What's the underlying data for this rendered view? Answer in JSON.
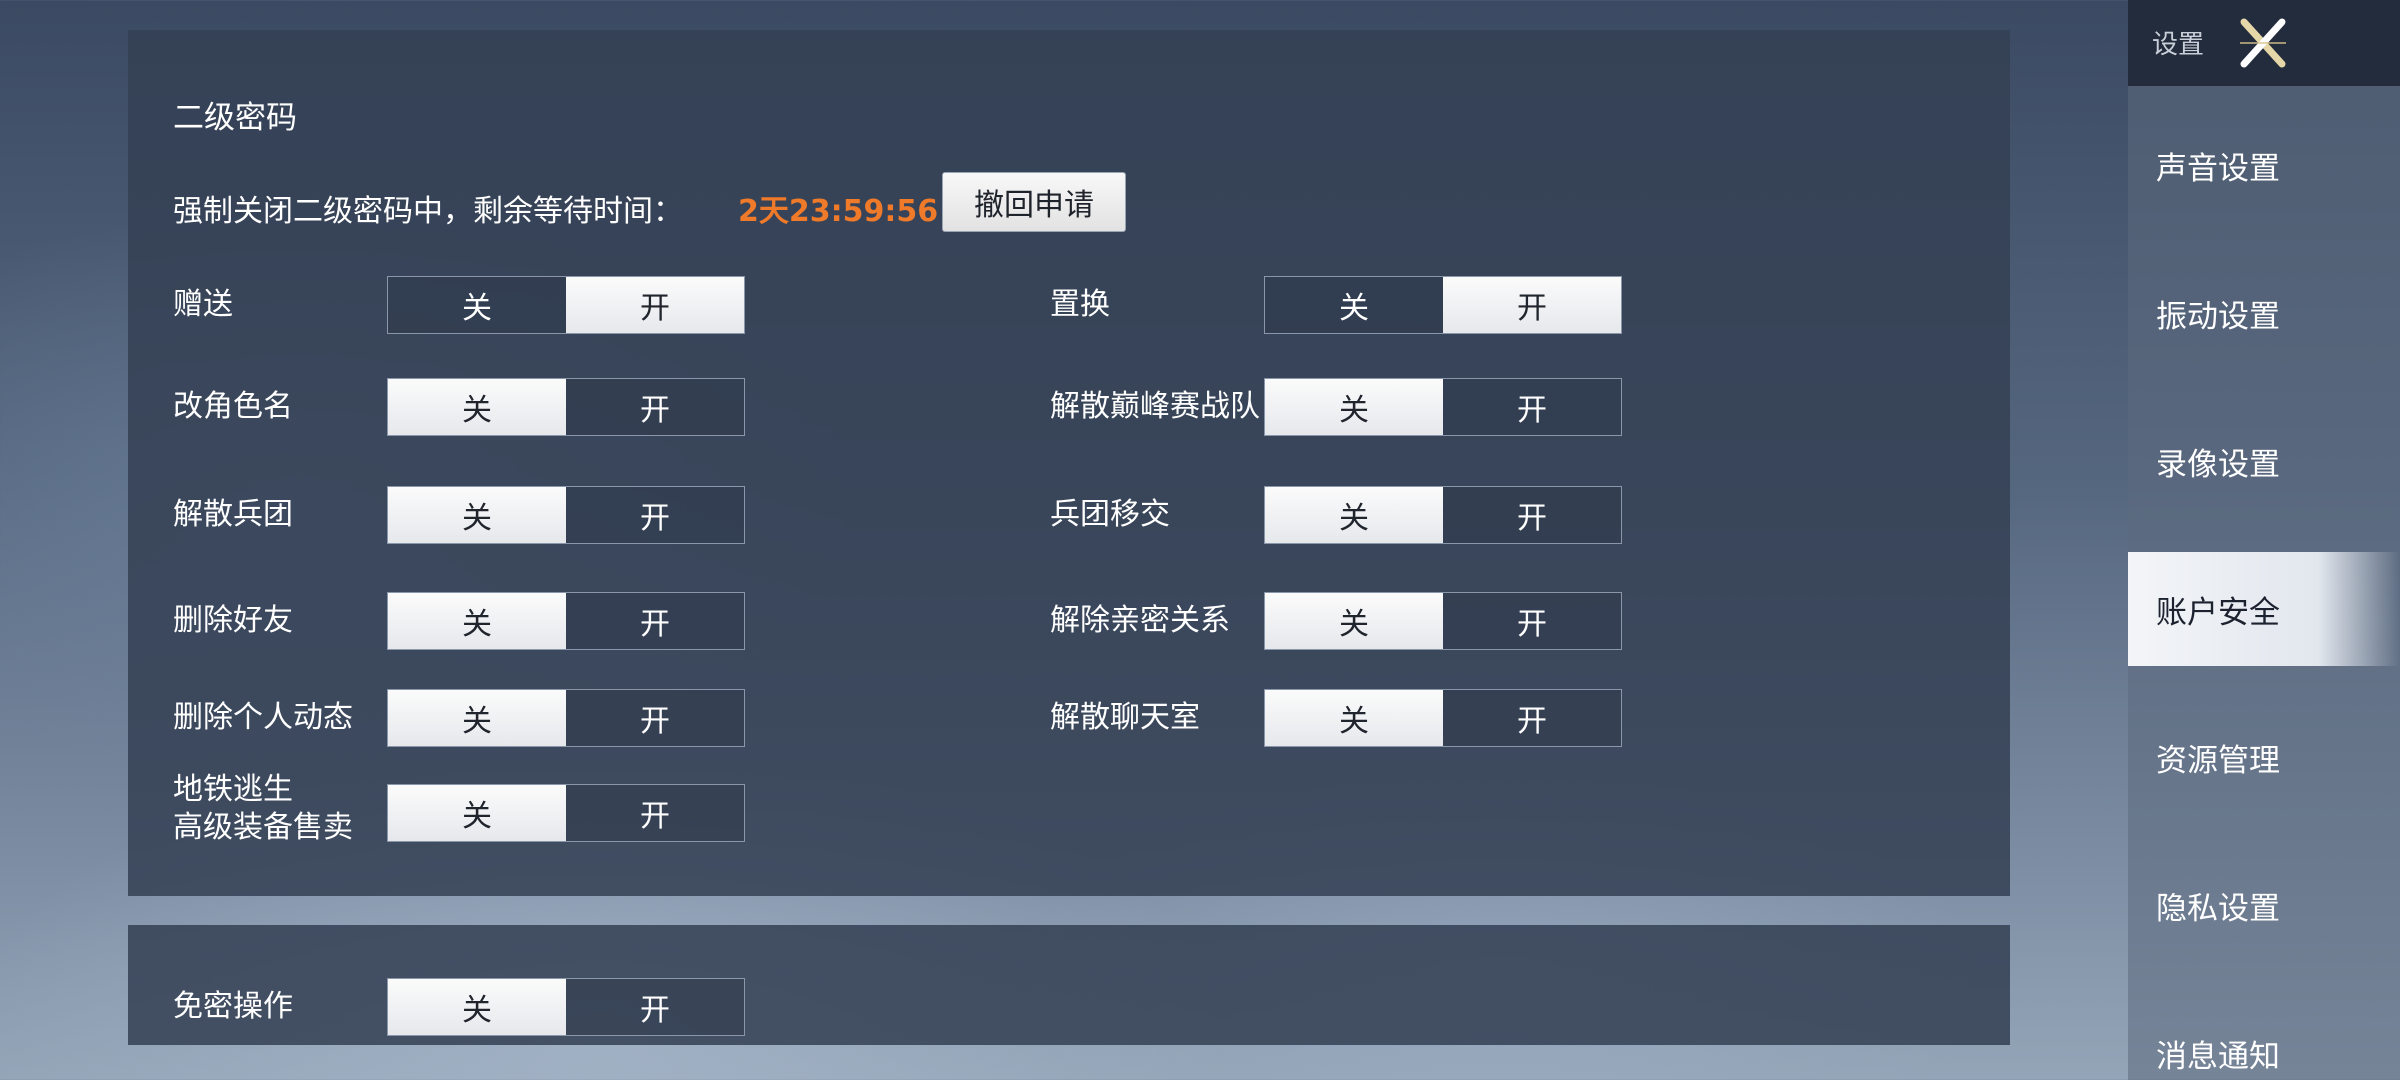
{
  "sidebar": {
    "title": "设置",
    "items": [
      {
        "label": "声音设置"
      },
      {
        "label": "振动设置"
      },
      {
        "label": "录像设置"
      },
      {
        "label": "账户安全"
      },
      {
        "label": "资源管理"
      },
      {
        "label": "隐私设置"
      },
      {
        "label": "消息通知"
      }
    ],
    "active_index": 3
  },
  "second_password": {
    "title": "二级密码",
    "notice": "强制关闭二级密码中，剩余等待时间：",
    "countdown": "2天23:59:56",
    "withdraw_label": "撤回申请",
    "off_label": "关",
    "on_label": "开",
    "settings": [
      {
        "label": "赠送",
        "state": "on"
      },
      {
        "label": "置换",
        "state": "on"
      },
      {
        "label": "改角色名",
        "state": "off"
      },
      {
        "label": "解散巅峰赛战队",
        "state": "off"
      },
      {
        "label": "解散兵团",
        "state": "off"
      },
      {
        "label": "兵团移交",
        "state": "off"
      },
      {
        "label": "删除好友",
        "state": "off"
      },
      {
        "label": "解除亲密关系",
        "state": "off"
      },
      {
        "label": "删除个人动态",
        "state": "off"
      },
      {
        "label": "解散聊天室",
        "state": "off"
      },
      {
        "label": "地铁逃生\n高级装备售卖",
        "state": "off"
      }
    ]
  },
  "password_free": {
    "label": "免密操作",
    "state": "off",
    "off_label": "关",
    "on_label": "开"
  },
  "colors": {
    "countdown": "#ee7a2a",
    "active_toggle": "#f2f3f5",
    "panel": "#344054"
  }
}
